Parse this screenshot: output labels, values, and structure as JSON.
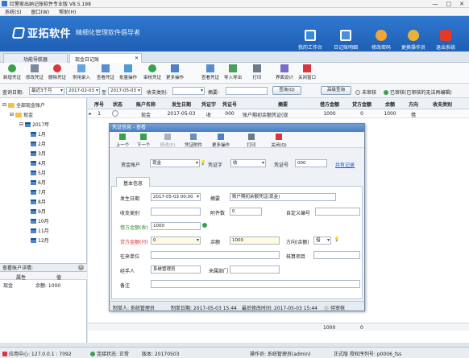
{
  "window": {
    "title": "红警家出纳记账软件专业版 V8.5.198",
    "min": "—",
    "max": "□",
    "close": "✕"
  },
  "menu": [
    "系统(S)",
    "窗口(W)",
    "帮助(H)"
  ],
  "brand": {
    "name": "亚拓软件",
    "tagline": "精细化管理软件倡导者"
  },
  "header_buttons": [
    {
      "label": "我的工作台",
      "icon": "monitor-icon",
      "color": "#3b87dd"
    },
    {
      "label": "日记账明细",
      "icon": "ledger-icon",
      "color": "#4d8ee0"
    },
    {
      "label": "修改密码",
      "icon": "user-key-icon",
      "color": "#f2a33a"
    },
    {
      "label": "更换操作员",
      "icon": "user-switch-icon",
      "color": "#e9b03c"
    },
    {
      "label": "退出系统",
      "icon": "power-icon",
      "color": "#e23a2a"
    }
  ],
  "tabs": [
    "功能导航器",
    "现金日记账"
  ],
  "tab_close": "✕",
  "toolbar": [
    "新增凭证",
    "修改凭证",
    "删除凭证",
    "常用录入",
    "查看凭证",
    "批量操作",
    "审核凭证",
    "更多操作",
    "查看凭证",
    "导入导出",
    "打印",
    "界面设计",
    "关闭窗口"
  ],
  "filter": {
    "date_label": "查询日期:",
    "range": "最近3个月",
    "date_from": "2017-02-03",
    "to": "至",
    "date_to": "2017-05-03",
    "category_label": "收支类别:",
    "summary_label": "摘要:",
    "query_btn": "查询(Q)",
    "advanced_btn": "高级查询",
    "unaudited": "未审核",
    "audited": "已审核(已审核的无法再编辑)"
  },
  "tree": {
    "root": "全部现金账户",
    "account": "现金",
    "year": "2017年",
    "months": [
      "1月",
      "2月",
      "3月",
      "4月",
      "5月",
      "6月",
      "7月",
      "8月",
      "9月",
      "10月",
      "11月",
      "12月"
    ]
  },
  "detail": {
    "title": "查看账户详情:",
    "col1": "属性",
    "col2": "值",
    "row_name": "现金",
    "row_value": "余额: 1000"
  },
  "grid": {
    "headers": [
      "序号",
      "状态",
      "账户名称",
      "发生日期",
      "凭证字",
      "凭证号",
      "摘要",
      "借方金额",
      "贷方金额",
      "余额",
      "方向",
      "收支类别"
    ],
    "rows": [
      [
        "1",
        "",
        "现金",
        "2017-05-03",
        "收",
        "000",
        "账户期初余额凭证(现",
        "1000",
        "0",
        "1000",
        "借",
        ""
      ]
    ],
    "footer_debit": "1000",
    "footer_credit": "0"
  },
  "modal": {
    "title": "凭证信息 - 查看",
    "toolbar": [
      "上一个",
      "下一个",
      "修改(E)",
      "凭证附件",
      "更多操作",
      "打印",
      "关闭(Q)"
    ],
    "account_label": "资金账户",
    "account": "现金",
    "voucher_label": "凭证字",
    "voucher": "收",
    "voucher_no_label": "凭证号",
    "voucher_no": "000",
    "share_link": "共有记录",
    "tab": "基本信息",
    "date_label": "发生日期",
    "date": "2017-05-03 00:00",
    "summary_label": "摘要",
    "summary": "账户期初余额凭证(现金)",
    "category_label": "收支类别",
    "attachments_label": "附件数",
    "attachments": "0",
    "custom_no_label": "自定义编号",
    "debit_label": "借方金额(收)",
    "debit": "1000",
    "credit_label": "贷方金额(付)",
    "credit": "0",
    "balance_label": "余额",
    "balance": "1000",
    "direction_label": "方向(余额)",
    "direction": "借",
    "partner_label": "往来单位",
    "item_label": "核算项目",
    "handler_label": "经手人",
    "handler": "系统管理员",
    "dept_label": "来属部门",
    "note_label": "备注",
    "creator": "制单人: 系统管理员",
    "created": "制单日期: 2017-05-03 15:44",
    "modified": "最后修改时间: 2017-05-03 15:44",
    "audit": "待审核"
  },
  "statusbar": {
    "app": "应用中心: 127.0.0.1 : 7092",
    "connection": "连接状态: 正常",
    "version": "版本: 20170503",
    "operator": "操作员: 系统管理员(admin)",
    "license": "正式版 授权序列号: p0006_fss"
  }
}
